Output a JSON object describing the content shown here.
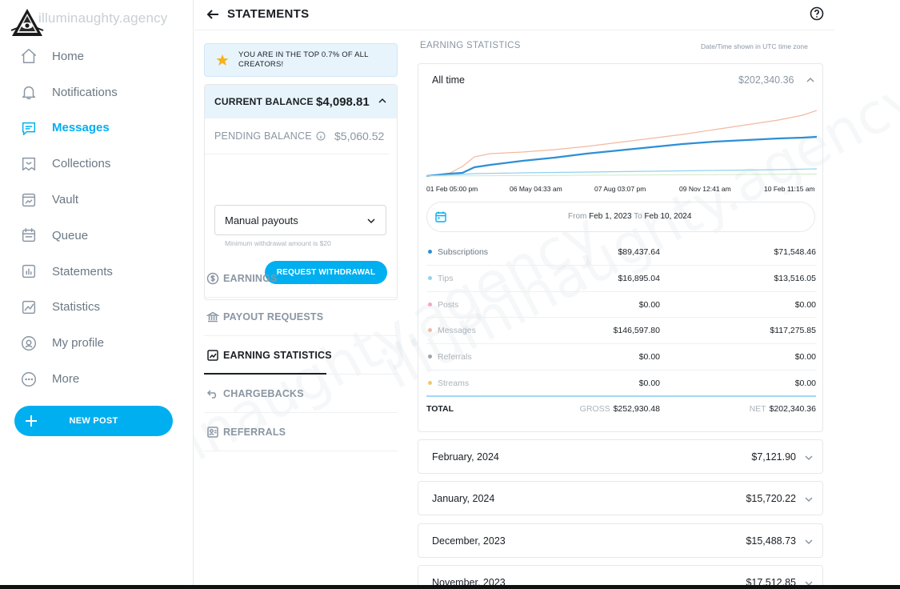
{
  "brand": {
    "wordmark": "illuminaughty.agency"
  },
  "sidebar": {
    "items": [
      {
        "label": "Home",
        "icon": "home-icon"
      },
      {
        "label": "Notifications",
        "icon": "bell-icon"
      },
      {
        "label": "Messages",
        "icon": "message-icon",
        "active": true
      },
      {
        "label": "Collections",
        "icon": "bookmark-icon"
      },
      {
        "label": "Vault",
        "icon": "image-icon"
      },
      {
        "label": "Queue",
        "icon": "calendar-icon"
      },
      {
        "label": "Statements",
        "icon": "statements-icon"
      },
      {
        "label": "Statistics",
        "icon": "chart-icon"
      },
      {
        "label": "My profile",
        "icon": "profile-icon"
      },
      {
        "label": "More",
        "icon": "more-icon"
      }
    ],
    "new_post": "NEW POST"
  },
  "header": {
    "title": "STATEMENTS"
  },
  "banner": {
    "text": "YOU ARE IN THE TOP 0.7% OF ALL CREATORS!"
  },
  "balance": {
    "current_label": "CURRENT BALANCE",
    "current_value": "$4,098.81",
    "pending_label": "PENDING BALANCE",
    "pending_value": "$5,060.52",
    "payout_option": "Manual payouts",
    "min_note": "Minimum withdrawal amount is $20",
    "request_btn": "REQUEST WITHDRAWAL"
  },
  "sections": [
    {
      "label": "EARNINGS",
      "icon": "dollar-icon"
    },
    {
      "label": "PAYOUT REQUESTS",
      "icon": "bank-icon"
    },
    {
      "label": "EARNING STATISTICS",
      "icon": "trend-icon",
      "active": true
    },
    {
      "label": "CHARGEBACKS",
      "icon": "undo-icon"
    },
    {
      "label": "REFERRALS",
      "icon": "referral-icon"
    }
  ],
  "stats": {
    "heading": "EARNING STATISTICS",
    "tz_note": "Date/Time shown in UTC time zone",
    "period_label": "All time",
    "period_value": "$202,340.36",
    "x_ticks": [
      "01 Feb 05:00 pm",
      "06 May 04:33 am",
      "07 Aug 03:07 pm",
      "09 Nov 12:41 am",
      "10 Feb 11:15 am"
    ],
    "from_label": "From",
    "from_date": "Feb 1, 2023",
    "to_label": "To",
    "to_date": "Feb 10, 2024",
    "rows": [
      {
        "name": "Subscriptions",
        "gross": "$89,437.64",
        "net": "$71,548.46",
        "color": "#2d8fd5"
      },
      {
        "name": "Tips",
        "gross": "$16,895.04",
        "net": "$13,516.05",
        "color": "#8fd3ee"
      },
      {
        "name": "Posts",
        "gross": "$0.00",
        "net": "$0.00",
        "color": "#f0a9c0"
      },
      {
        "name": "Messages",
        "gross": "$146,597.80",
        "net": "$117,275.85",
        "color": "#f2b9a0"
      },
      {
        "name": "Referrals",
        "gross": "$0.00",
        "net": "$0.00",
        "color": "#9aa6b2"
      },
      {
        "name": "Streams",
        "gross": "$0.00",
        "net": "$0.00",
        "color": "#f4c76a"
      }
    ],
    "total_label": "TOTAL",
    "gross_label": "GROSS",
    "gross_total": "$252,930.48",
    "net_label": "NET",
    "net_total": "$202,340.36"
  },
  "months": [
    {
      "name": "February, 2024",
      "value": "$7,121.90"
    },
    {
      "name": "January, 2024",
      "value": "$15,720.22"
    },
    {
      "name": "December, 2023",
      "value": "$15,488.73"
    },
    {
      "name": "November, 2023",
      "value": "$17,512.85"
    }
  ],
  "colors": {
    "accent": "#00aff0",
    "banner_bg": "#e8f4fb"
  }
}
